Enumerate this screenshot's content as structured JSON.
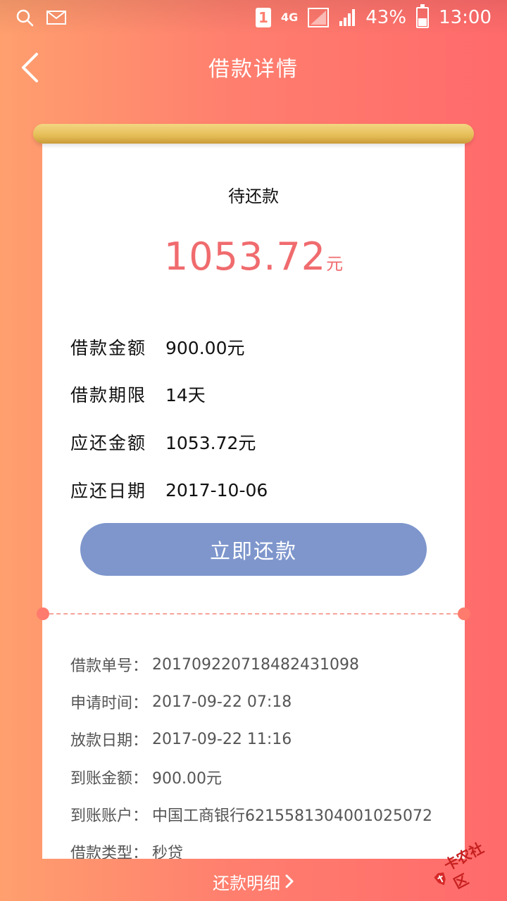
{
  "status_bar": {
    "sim": "1",
    "network": "4G",
    "battery": "43%",
    "time": "13:00"
  },
  "header": {
    "title": "借款详情"
  },
  "summary": {
    "label": "待还款",
    "amount": "1053.72",
    "unit": "元"
  },
  "loan_info": [
    {
      "key": "借款金额",
      "value": "900.00元"
    },
    {
      "key": "借款期限",
      "value": "14天"
    },
    {
      "key": "应还金额",
      "value": "1053.72元"
    },
    {
      "key": "应还日期",
      "value": "2017-10-06"
    }
  ],
  "pay_button": "立即还款",
  "details": [
    {
      "key": "借款单号：",
      "value": "201709220718482431098"
    },
    {
      "key": "申请时间：",
      "value": "2017-09-22 07:18"
    },
    {
      "key": "放款日期：",
      "value": "2017-09-22 11:16"
    },
    {
      "key": "到账金额：",
      "value": "900.00元"
    },
    {
      "key": "到账账户：",
      "value": "中国工商银行6215581304001025072"
    },
    {
      "key": "借款类型：",
      "value": "秒贷"
    }
  ],
  "bottom_link": "还款明细",
  "watermark": "卡农社区",
  "colors": {
    "accent": "#f06b6e",
    "button": "#7e96cc",
    "rod": "#e5bd57"
  }
}
